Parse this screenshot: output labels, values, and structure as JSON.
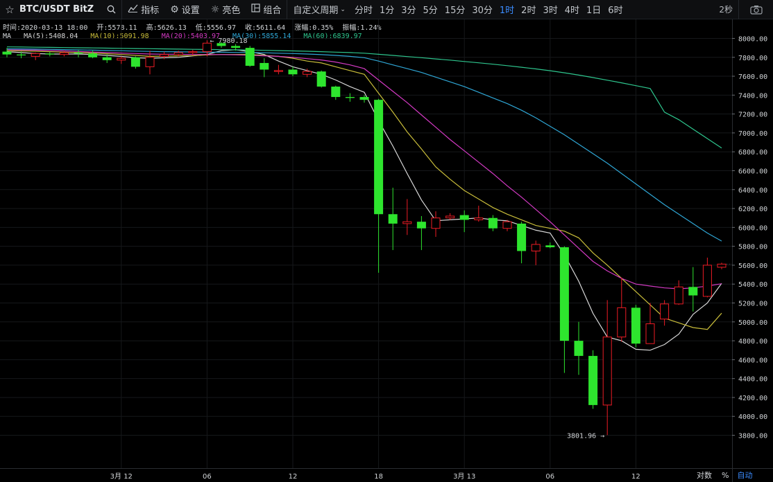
{
  "toolbar": {
    "symbol": "BTC/USDT BitZ",
    "indicators": "指标",
    "settings": "设置",
    "theme": "亮色",
    "combo": "组合",
    "custom_period": "自定义周期",
    "periods": [
      "分时",
      "1分",
      "3分",
      "5分",
      "15分",
      "30分",
      "1时",
      "2时",
      "3时",
      "4时",
      "1日",
      "6时"
    ],
    "active_period": "1时",
    "refresh": "2秒"
  },
  "info": {
    "time": "时间:2020-03-13 18:00",
    "open": "开:5578.11",
    "high": "高:5626.13",
    "low": "低:5556.97",
    "close": "收:5611.64",
    "change": "涨幅:0.35%",
    "amplitude": "振幅:1.24%"
  },
  "ma": {
    "label": "MA",
    "ma5": "MA(5):5408.04",
    "ma10": "MA(10):5091.98",
    "ma20": "MA(20):5403.97",
    "ma30": "MA(30):5855.14",
    "ma60": "MA(60):6839.97"
  },
  "colors": {
    "up": "#ee1c25",
    "down": "#2ee52e",
    "ma5": "#d9d9d9",
    "ma10": "#c9bd3a",
    "ma20": "#d43ac4",
    "ma30": "#2fa7d6",
    "ma60": "#2ec68e",
    "active": "#3b8cff"
  },
  "bottom": {
    "log": "对数",
    "pct": "%",
    "auto": "自动"
  },
  "chart_data": {
    "type": "candlestick",
    "interval": "1h",
    "ylim": [
      3650,
      8150
    ],
    "y_ticks": [
      3800,
      4000,
      4200,
      4400,
      4600,
      4800,
      5000,
      5200,
      5400,
      5600,
      5800,
      6000,
      6200,
      6400,
      6600,
      6800,
      7000,
      7200,
      7400,
      7600,
      7800,
      8000
    ],
    "x_labels": [
      "3月 12",
      "06",
      "12",
      "18",
      "3月 13",
      "06",
      "12"
    ],
    "annotations": [
      {
        "text": "7980.18",
        "value": 7980.18
      },
      {
        "text": "3801.96",
        "value": 3801.96
      }
    ],
    "candles": [
      {
        "o": 7860,
        "h": 7900,
        "l": 7800,
        "c": 7830
      },
      {
        "o": 7830,
        "h": 7860,
        "l": 7790,
        "c": 7820
      },
      {
        "o": 7810,
        "h": 7850,
        "l": 7770,
        "c": 7840
      },
      {
        "o": 7840,
        "h": 7860,
        "l": 7810,
        "c": 7830
      },
      {
        "o": 7830,
        "h": 7870,
        "l": 7810,
        "c": 7850
      },
      {
        "o": 7850,
        "h": 7880,
        "l": 7800,
        "c": 7840
      },
      {
        "o": 7840,
        "h": 7870,
        "l": 7790,
        "c": 7800
      },
      {
        "o": 7800,
        "h": 7830,
        "l": 7740,
        "c": 7770
      },
      {
        "o": 7770,
        "h": 7810,
        "l": 7730,
        "c": 7790
      },
      {
        "o": 7800,
        "h": 7810,
        "l": 7680,
        "c": 7700
      },
      {
        "o": 7700,
        "h": 7870,
        "l": 7620,
        "c": 7800
      },
      {
        "o": 7810,
        "h": 7860,
        "l": 7780,
        "c": 7830
      },
      {
        "o": 7830,
        "h": 7870,
        "l": 7810,
        "c": 7850
      },
      {
        "o": 7850,
        "h": 7880,
        "l": 7820,
        "c": 7860
      },
      {
        "o": 7860,
        "h": 7980,
        "l": 7810,
        "c": 7950
      },
      {
        "o": 7950,
        "h": 7960,
        "l": 7900,
        "c": 7920
      },
      {
        "o": 7920,
        "h": 7940,
        "l": 7870,
        "c": 7900
      },
      {
        "o": 7900,
        "h": 7920,
        "l": 7700,
        "c": 7710
      },
      {
        "o": 7740,
        "h": 7790,
        "l": 7590,
        "c": 7670
      },
      {
        "o": 7650,
        "h": 7720,
        "l": 7620,
        "c": 7660
      },
      {
        "o": 7670,
        "h": 7700,
        "l": 7600,
        "c": 7620
      },
      {
        "o": 7620,
        "h": 7680,
        "l": 7590,
        "c": 7650
      },
      {
        "o": 7650,
        "h": 7660,
        "l": 7480,
        "c": 7490
      },
      {
        "o": 7490,
        "h": 7500,
        "l": 7350,
        "c": 7380
      },
      {
        "o": 7380,
        "h": 7420,
        "l": 7330,
        "c": 7370
      },
      {
        "o": 7380,
        "h": 7400,
        "l": 7320,
        "c": 7350
      },
      {
        "o": 7350,
        "h": 7360,
        "l": 5520,
        "c": 6140
      },
      {
        "o": 6140,
        "h": 6420,
        "l": 5760,
        "c": 6040
      },
      {
        "o": 6040,
        "h": 6300,
        "l": 5920,
        "c": 6060
      },
      {
        "o": 6060,
        "h": 6120,
        "l": 5760,
        "c": 5990
      },
      {
        "o": 5990,
        "h": 6170,
        "l": 5900,
        "c": 6100
      },
      {
        "o": 6100,
        "h": 6150,
        "l": 6080,
        "c": 6120
      },
      {
        "o": 6130,
        "h": 6180,
        "l": 5950,
        "c": 6080
      },
      {
        "o": 6080,
        "h": 6230,
        "l": 6060,
        "c": 6100
      },
      {
        "o": 6100,
        "h": 6130,
        "l": 5960,
        "c": 5990
      },
      {
        "o": 5990,
        "h": 6080,
        "l": 5960,
        "c": 6060
      },
      {
        "o": 6040,
        "h": 6060,
        "l": 5620,
        "c": 5750
      },
      {
        "o": 5750,
        "h": 5860,
        "l": 5600,
        "c": 5820
      },
      {
        "o": 5810,
        "h": 5840,
        "l": 5780,
        "c": 5790
      },
      {
        "o": 5790,
        "h": 5800,
        "l": 4460,
        "c": 4800
      },
      {
        "o": 4800,
        "h": 5000,
        "l": 4440,
        "c": 4640
      },
      {
        "o": 4640,
        "h": 4700,
        "l": 4080,
        "c": 4120
      },
      {
        "o": 4120,
        "h": 5230,
        "l": 3801.96,
        "c": 4840
      },
      {
        "o": 4840,
        "h": 5470,
        "l": 4790,
        "c": 5150
      },
      {
        "o": 5150,
        "h": 5180,
        "l": 4730,
        "c": 4770
      },
      {
        "o": 4770,
        "h": 5200,
        "l": 4770,
        "c": 4980
      },
      {
        "o": 5030,
        "h": 5230,
        "l": 4960,
        "c": 5190
      },
      {
        "o": 5190,
        "h": 5440,
        "l": 5180,
        "c": 5370
      },
      {
        "o": 5370,
        "h": 5580,
        "l": 5110,
        "c": 5280
      },
      {
        "o": 5270,
        "h": 5680,
        "l": 5260,
        "c": 5600
      },
      {
        "o": 5578.11,
        "h": 5626.13,
        "l": 5556.97,
        "c": 5611.64
      }
    ],
    "ma_lines": {
      "MA5": [
        7860,
        7850,
        7840,
        7835,
        7835,
        7835,
        7830,
        7820,
        7810,
        7795,
        7790,
        7795,
        7800,
        7815,
        7830,
        7870,
        7880,
        7860,
        7830,
        7760,
        7700,
        7660,
        7620,
        7560,
        7490,
        7430,
        7130,
        6860,
        6570,
        6290,
        6070,
        6080,
        6090,
        6100,
        6080,
        6070,
        6020,
        5970,
        5940,
        5710,
        5430,
        5090,
        4840,
        4800,
        4710,
        4700,
        4760,
        4870,
        5080,
        5200,
        5408.04
      ],
      "MA10": [
        7870,
        7868,
        7864,
        7860,
        7855,
        7850,
        7845,
        7838,
        7830,
        7820,
        7810,
        7812,
        7815,
        7818,
        7825,
        7830,
        7830,
        7830,
        7820,
        7810,
        7790,
        7760,
        7740,
        7700,
        7660,
        7620,
        7420,
        7220,
        7010,
        6830,
        6640,
        6510,
        6390,
        6300,
        6210,
        6140,
        6080,
        6020,
        5990,
        5960,
        5890,
        5730,
        5600,
        5460,
        5320,
        5180,
        5040,
        4990,
        4940,
        4920,
        5091.98
      ],
      "MA20": [
        7880,
        7878,
        7876,
        7872,
        7868,
        7862,
        7856,
        7850,
        7845,
        7840,
        7835,
        7833,
        7832,
        7830,
        7830,
        7829,
        7826,
        7822,
        7816,
        7810,
        7800,
        7786,
        7772,
        7750,
        7720,
        7680,
        7560,
        7440,
        7320,
        7190,
        7060,
        6930,
        6810,
        6690,
        6570,
        6440,
        6320,
        6190,
        6060,
        5920,
        5780,
        5640,
        5540,
        5460,
        5400,
        5380,
        5360,
        5350,
        5360,
        5380,
        5403.97
      ],
      "MA30": [
        7890,
        7889,
        7887,
        7885,
        7882,
        7879,
        7876,
        7872,
        7869,
        7866,
        7863,
        7860,
        7858,
        7857,
        7855,
        7854,
        7852,
        7850,
        7848,
        7844,
        7840,
        7835,
        7828,
        7820,
        7810,
        7796,
        7760,
        7720,
        7680,
        7640,
        7590,
        7540,
        7490,
        7430,
        7370,
        7310,
        7240,
        7160,
        7070,
        6980,
        6880,
        6780,
        6680,
        6570,
        6460,
        6350,
        6240,
        6140,
        6040,
        5940,
        5855.14
      ],
      "MA60": [
        7910,
        7909,
        7907,
        7905,
        7903,
        7901,
        7899,
        7897,
        7895,
        7893,
        7891,
        7889,
        7887,
        7885,
        7883,
        7881,
        7879,
        7877,
        7874,
        7871,
        7868,
        7864,
        7860,
        7855,
        7850,
        7844,
        7832,
        7820,
        7808,
        7796,
        7783,
        7770,
        7756,
        7742,
        7727,
        7712,
        7695,
        7677,
        7658,
        7636,
        7612,
        7586,
        7558,
        7530,
        7500,
        7470,
        7220,
        7140,
        7040,
        6940,
        6839.97
      ]
    }
  }
}
